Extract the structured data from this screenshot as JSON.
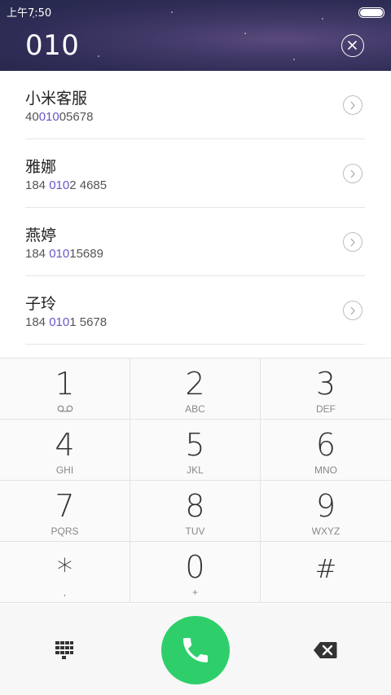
{
  "status_bar": {
    "time": "上午7:50"
  },
  "dialer": {
    "input": "010"
  },
  "results": [
    {
      "name": "小米客服",
      "num_pre": "40",
      "num_hl": "010",
      "num_post": "05678"
    },
    {
      "name": "雅娜",
      "num_pre": "184 ",
      "num_hl": "010",
      "num_post": "2 4685"
    },
    {
      "name": "燕婷",
      "num_pre": "184 ",
      "num_hl": "010",
      "num_post": "15689"
    },
    {
      "name": "子玲",
      "num_pre": "184 ",
      "num_hl": "010",
      "num_post": "1 5678"
    }
  ],
  "keys": [
    {
      "digit": "1",
      "letters": ""
    },
    {
      "digit": "2",
      "letters": "ABC"
    },
    {
      "digit": "3",
      "letters": "DEF"
    },
    {
      "digit": "4",
      "letters": "GHI"
    },
    {
      "digit": "5",
      "letters": "JKL"
    },
    {
      "digit": "6",
      "letters": "MNO"
    },
    {
      "digit": "7",
      "letters": "PQRS"
    },
    {
      "digit": "8",
      "letters": "TUV"
    },
    {
      "digit": "9",
      "letters": "WXYZ"
    },
    {
      "digit": "*",
      "letters": ","
    },
    {
      "digit": "0",
      "letters": "+"
    },
    {
      "digit": "#",
      "letters": ""
    }
  ],
  "icons": {
    "clear": "clear-circle-icon",
    "detail": "chevron-right-circle-icon",
    "voicemail": "voicemail-icon",
    "dialpad": "dialpad-icon",
    "call": "phone-icon",
    "backspace": "backspace-icon"
  },
  "colors": {
    "highlight": "#6a55c8",
    "call_button": "#2ecf6b"
  }
}
